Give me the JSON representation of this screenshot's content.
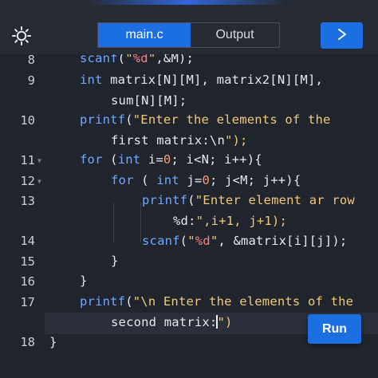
{
  "tabs": [
    {
      "label": "main.c",
      "active": true
    },
    {
      "label": "Output",
      "active": false
    }
  ],
  "icons": {
    "settings": "gear-icon",
    "play": "play-icon"
  },
  "colors": {
    "accent": "#1c6fe0",
    "background": "#20242d",
    "keyword": "#6fa8ff",
    "string": "#f0c878",
    "number": "#ff9b73"
  },
  "run_button": {
    "label": "Run"
  },
  "editor": {
    "line_numbers": [
      "8",
      "9",
      "10",
      "11",
      "12",
      "13",
      "14",
      "15",
      "16",
      "17",
      "18"
    ],
    "lines": [
      "scanf(\"%d\",&M);",
      "int matrix[N][M], matrix2[N][M],",
      "sum[N][M];",
      "printf(\"Enter the elements of the",
      "first matrix:\\n\");",
      "for (int i=0; i<N; i++){",
      "for ( int j=0; j<M; j++){",
      "printf(\"Enter element ar row",
      "%d:\",i+1, j+1);",
      "scanf(\"%d\", &matrix[i][j]);",
      "}",
      "}",
      "printf(\"\\n Enter the elements of the",
      "second matrix:\")",
      "}"
    ]
  }
}
